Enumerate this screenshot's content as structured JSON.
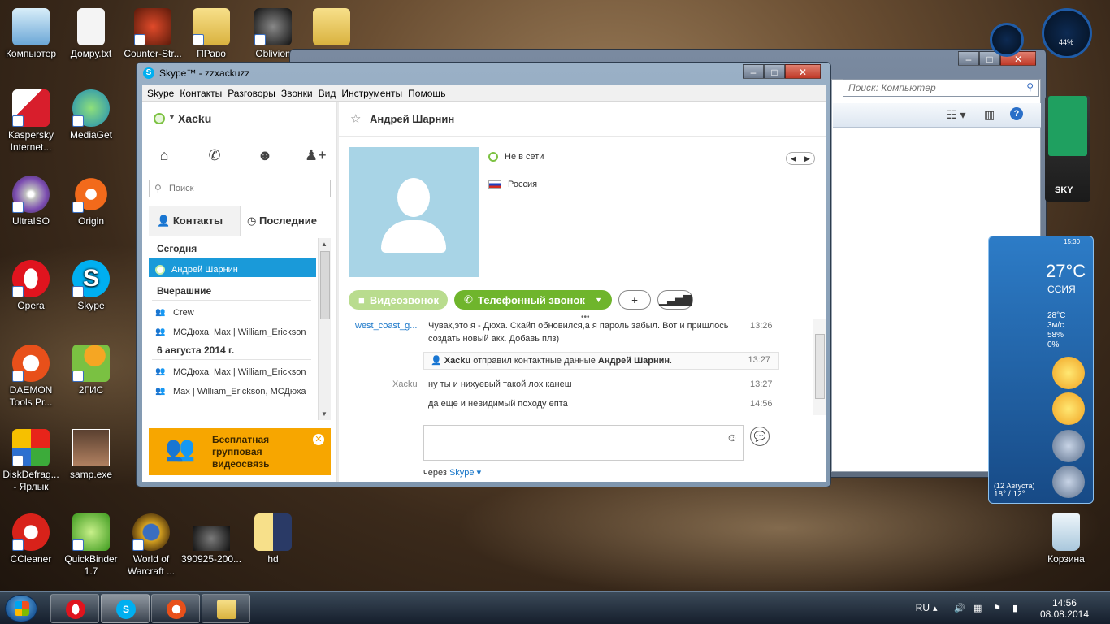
{
  "desktop": {
    "icons": [
      {
        "label": "Компьютер",
        "icon": "computer-icon"
      },
      {
        "label": "Домру.txt",
        "icon": "text-file-icon"
      },
      {
        "label": "Counter-Str...",
        "icon": "counter-strike-icon"
      },
      {
        "label": "ПРаво",
        "icon": "folder-icon"
      },
      {
        "label": "Oblivion",
        "icon": "oblivion-icon"
      },
      {
        "label": "Kaspersky Internet...",
        "icon": "kaspersky-icon"
      },
      {
        "label": "MediaGet",
        "icon": "mediaget-icon"
      },
      {
        "label": "UltraISO",
        "icon": "ultraiso-icon"
      },
      {
        "label": "Origin",
        "icon": "origin-icon"
      },
      {
        "label": "Opera",
        "icon": "opera-icon"
      },
      {
        "label": "Skype",
        "icon": "skype-icon"
      },
      {
        "label": "DAEMON Tools Pr...",
        "icon": "daemon-tools-icon"
      },
      {
        "label": "2ГИС",
        "icon": "2gis-icon"
      },
      {
        "label": "DiskDefrag... - Ярлык",
        "icon": "diskdefrag-icon"
      },
      {
        "label": "samp.exe",
        "icon": "samp-icon"
      },
      {
        "label": "CCleaner",
        "icon": "ccleaner-icon"
      },
      {
        "label": "QuickBinder 1.7",
        "icon": "quickbinder-icon"
      },
      {
        "label": "World of Warcraft ...",
        "icon": "wow-icon"
      },
      {
        "label": "390925-200...",
        "icon": "image-file-icon"
      },
      {
        "label": "hd",
        "icon": "folder-icon"
      },
      {
        "label": "Корзина",
        "icon": "recycle-bin-icon"
      }
    ]
  },
  "explorer": {
    "search_placeholder": "Поиск: Компьютер"
  },
  "gadgets": {
    "cpu_percent_label": "44%",
    "weather": {
      "time": "15:30",
      "temp": "27°C",
      "city": "ССИЯ",
      "temp2": "28°C",
      "wind": "3м/с",
      "humidity": "58%",
      "precip": "0%",
      "date_label": "(12 Августа)",
      "range": "18° / 12°"
    }
  },
  "skype": {
    "title": "Skype™ - zzxackuzz",
    "menu": [
      "Skype",
      "Контакты",
      "Разговоры",
      "Звонки",
      "Вид",
      "Инструменты",
      "Помощь"
    ],
    "me_name": "Xacku",
    "search_placeholder": "Поиск",
    "tabs": {
      "contacts": "Контакты",
      "recent": "Последние"
    },
    "recent": {
      "today": "Сегодня",
      "today_items": [
        "Андрей Шарнин"
      ],
      "yesterday": "Вчерашние",
      "yesterday_items": [
        "Crew",
        "МСДюха, Max | William_Erickson"
      ],
      "aug6": "6 августа 2014 г.",
      "aug6_items": [
        "МСДюха, Max | William_Erickson",
        "Max | William_Erickson, МСДюха"
      ]
    },
    "promo": {
      "line1": "Бесплатная",
      "line2": "групповая",
      "line3": "видеосвязь"
    },
    "contact": {
      "name": "Андрей Шарнин",
      "status": "Не в сети",
      "country": "Россия"
    },
    "buttons": {
      "video": "Видеозвонок",
      "phone": "Телефонный звонок",
      "add": "+",
      "signal": "signal-icon"
    },
    "chat": {
      "m1_sender": "west_coast_g...",
      "m1_line1": "Чувак,это я - Дюха. Скайп обновился,а я пароль забыл. Вот и пришлось",
      "m1_line2": "создать новый акк. Добавь плз)",
      "m1_time": "13:26",
      "sys_sender": "Xacku",
      "sys_mid": " отправил контактные данные ",
      "sys_contact": "Андрей Шарнин",
      "sys_end": ".",
      "sys_time": "13:27",
      "m2_sender": "Xacku",
      "m2_text": "ну ты и нихуевый такой лох канеш",
      "m2_time": "13:27",
      "m3_text": "да еще и невидимый походу епта",
      "m3_time": "14:56"
    },
    "compose": {
      "value": "",
      "via_prefix": "через",
      "via_link": "Skype"
    }
  },
  "taskbar": {
    "lang": "RU",
    "time": "14:56",
    "date": "08.08.2014"
  }
}
